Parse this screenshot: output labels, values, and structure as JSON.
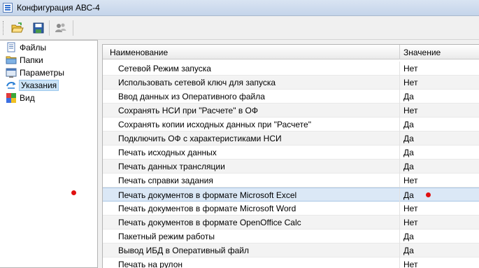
{
  "window": {
    "title": "Конфигурация АВС-4"
  },
  "toolbar": {
    "buttons": [
      {
        "icon": "open-folder-icon"
      },
      {
        "icon": "save-icon"
      },
      {
        "icon": "users-icon"
      }
    ]
  },
  "tree": {
    "items": [
      {
        "label": "Файлы",
        "icon": "files-icon"
      },
      {
        "label": "Папки",
        "icon": "folder-icon"
      },
      {
        "label": "Параметры",
        "icon": "parameters-icon"
      },
      {
        "label": "Указания",
        "icon": "directions-icon",
        "selected": true
      },
      {
        "label": "Вид",
        "icon": "view-icon"
      }
    ]
  },
  "grid": {
    "columns": [
      "Наименование",
      "Значение"
    ],
    "rows": [
      {
        "name": "Сетевой Режим запуска",
        "value": "Нет"
      },
      {
        "name": "Использовать сетевой ключ для запуска",
        "value": "Нет"
      },
      {
        "name": "Ввод данных из Оперативного файла",
        "value": "Да"
      },
      {
        "name": "Сохранять НСИ при \"Расчете\" в ОФ",
        "value": "Нет"
      },
      {
        "name": "Сохранять копии исходных данных при \"Расчете\"",
        "value": "Да"
      },
      {
        "name": "Подключить ОФ с характеристиками НСИ",
        "value": "Да"
      },
      {
        "name": "Печать исходных данных",
        "value": "Да"
      },
      {
        "name": "Печать данных трансляции",
        "value": "Да"
      },
      {
        "name": "Печать справки задания",
        "value": "Нет"
      },
      {
        "name": "Печать документов в формате Microsoft Excel",
        "value": "Да"
      },
      {
        "name": "Печать документов в формате Microsoft Word",
        "value": "Нет"
      },
      {
        "name": "Печать документов в формате OpenOffice Calc",
        "value": "Нет"
      },
      {
        "name": "Пакетный режим работы",
        "value": "Да"
      },
      {
        "name": "Вывод ИБД в Оперативный файл",
        "value": "Да"
      },
      {
        "name": "Печать на рулон",
        "value": "Нет"
      }
    ]
  },
  "colors": {
    "annotation_dot": "#e01010",
    "highlight_row": "#dbe8f6",
    "selection": "#cce4f7"
  }
}
